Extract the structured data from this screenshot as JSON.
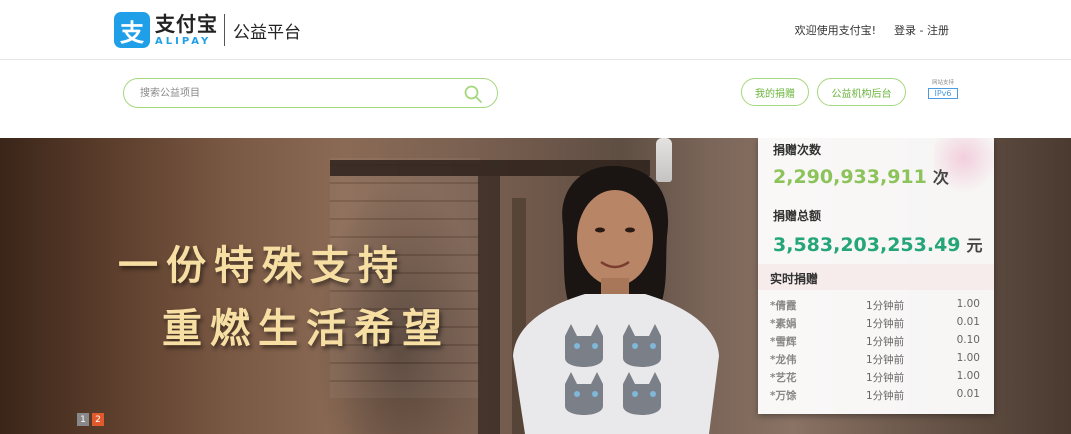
{
  "header": {
    "logo_icon": "alipay-zhi-icon",
    "logo_glyph": "支",
    "logo_cn": "支付宝",
    "logo_en": "ALIPAY",
    "platform_title": "公益平台",
    "welcome": "欢迎使用支付宝!",
    "login_register": "登录 - 注册"
  },
  "search": {
    "placeholder": "搜索公益项目",
    "icon": "search-icon"
  },
  "nav": {
    "my_donations": "我的捐赠",
    "org_backend": "公益机构后台",
    "ipv6_small": "网站支持",
    "ipv6_badge": "IPv6"
  },
  "banner": {
    "slogan_line1": "一份特殊支持",
    "slogan_line2": "重燃生活希望",
    "slides": [
      "1",
      "2"
    ],
    "active_slide": 2
  },
  "stats": {
    "donation_count_label": "捐赠次数",
    "donation_count": "2,290,933,911",
    "donation_count_unit": "次",
    "donation_total_label": "捐赠总额",
    "donation_total": "3,583,203,253.49",
    "donation_total_unit": "元",
    "realtime_title": "实时捐赠",
    "realtime": [
      {
        "name": "*倩霞",
        "time": "1分钟前",
        "amount": "1.00"
      },
      {
        "name": "*素娟",
        "time": "1分钟前",
        "amount": "0.01"
      },
      {
        "name": "*雪辉",
        "time": "1分钟前",
        "amount": "0.10"
      },
      {
        "name": "*龙伟",
        "time": "1分钟前",
        "amount": "1.00"
      },
      {
        "name": "*艺花",
        "time": "1分钟前",
        "amount": "1.00"
      },
      {
        "name": "*万馀",
        "time": "1分钟前",
        "amount": "0.01"
      }
    ]
  },
  "colors": {
    "brand_blue": "#1e9fe8",
    "accent_green": "#8cc35a",
    "teal": "#24a57a",
    "slide_active": "#e05a2b"
  }
}
